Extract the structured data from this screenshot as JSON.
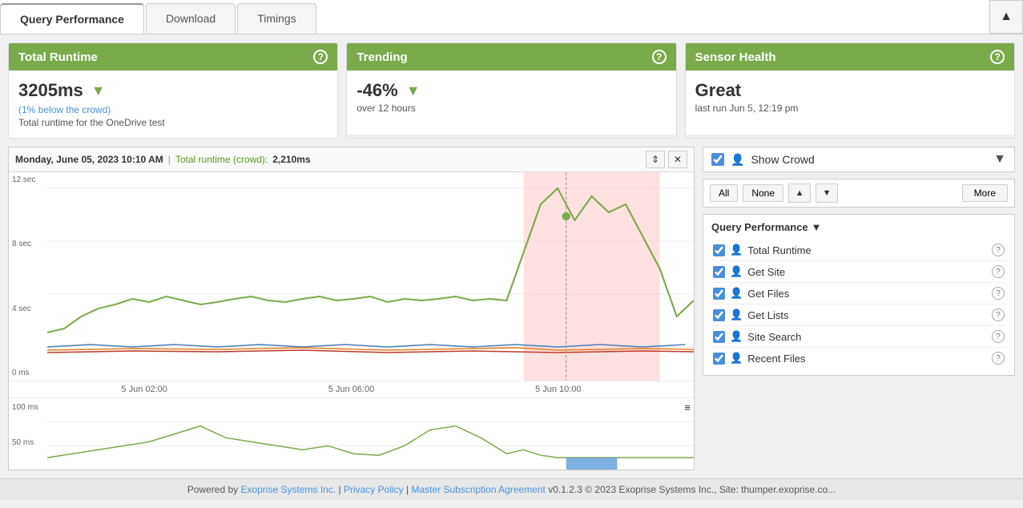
{
  "tabs": {
    "items": [
      {
        "label": "Query Performance",
        "active": true
      },
      {
        "label": "Download",
        "active": false
      },
      {
        "label": "Timings",
        "active": false
      }
    ],
    "collapse_icon": "▲"
  },
  "cards": {
    "total_runtime": {
      "title": "Total Runtime",
      "value": "3205ms",
      "subtext": "(1% below the crowd)",
      "desc": "Total runtime for the OneDrive test",
      "help": "?"
    },
    "trending": {
      "title": "Trending",
      "value": "-46%",
      "subtext": "over 12 hours",
      "help": "?"
    },
    "sensor_health": {
      "title": "Sensor Health",
      "value": "Great",
      "subtext": "last run Jun 5, 12:19 pm",
      "help": "?"
    }
  },
  "chart": {
    "tooltip_date": "Monday, June 05, 2023 10:10 AM",
    "tooltip_label": "Total runtime (crowd):",
    "tooltip_value": "2,210ms",
    "y_labels": [
      "12 sec",
      "8 sec",
      "4 sec",
      "0 ms"
    ],
    "x_labels": [
      "5 Jun 02:00",
      "5 Jun 06:00",
      "5 Jun 10:00"
    ],
    "mini_y_labels": [
      "100 ms",
      "50 ms"
    ],
    "resize_icon": "⇕",
    "close_icon": "✕",
    "hamburger_icon": "≡"
  },
  "sidebar": {
    "show_crowd_label": "Show Crowd",
    "filter": {
      "all_label": "All",
      "none_label": "None",
      "more_label": "More",
      "up_arrow": "▲",
      "down_arrow": "▼"
    },
    "query_section_title": "Query Performance",
    "query_items": [
      {
        "name": "Total Runtime",
        "icon_type": "blue",
        "checked": true
      },
      {
        "name": "Get Site",
        "icon_type": "blue",
        "checked": true
      },
      {
        "name": "Get Files",
        "icon_type": "red",
        "checked": true
      },
      {
        "name": "Get Lists",
        "icon_type": "blue",
        "checked": true
      },
      {
        "name": "Site Search",
        "icon_type": "orange",
        "checked": true
      },
      {
        "name": "Recent Files",
        "icon_type": "blue",
        "checked": true
      }
    ]
  },
  "footer": {
    "powered_by": "Powered by ",
    "company": "Exoprise Systems Inc.",
    "privacy": "Privacy Policy",
    "subscription": "Master Subscription Agreement",
    "version": "v0.1.2.3 © 2023 Exoprise Systems Inc., Site: thumper.exoprise.co..."
  }
}
